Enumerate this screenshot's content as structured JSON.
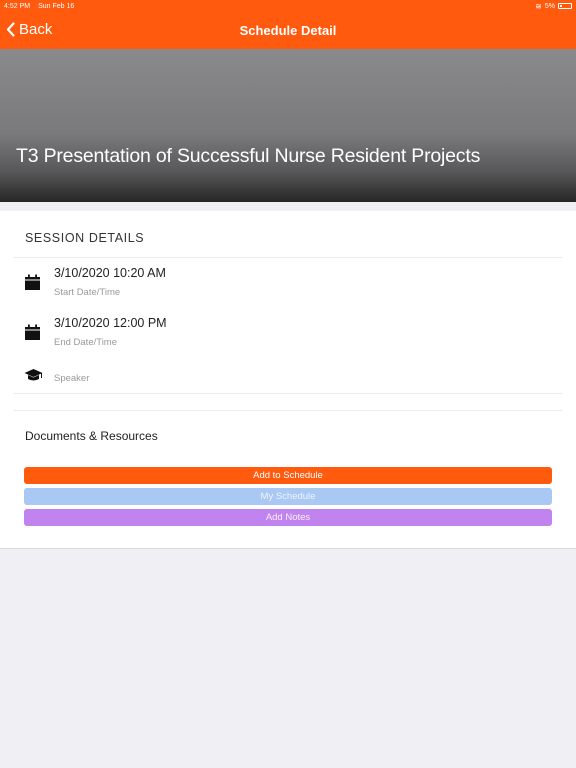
{
  "status_bar": {
    "time": "4:52 PM",
    "date": "Sun Feb 16",
    "battery": "5%"
  },
  "nav": {
    "back_label": "Back",
    "title": "Schedule Detail"
  },
  "hero": {
    "title": "T3 Presentation of Successful Nurse Resident Projects"
  },
  "session": {
    "header": "SESSION DETAILS",
    "start": {
      "value": "3/10/2020 10:20 AM",
      "label": "Start Date/Time",
      "icon": "calendar-icon"
    },
    "end": {
      "value": "3/10/2020 12:00 PM",
      "label": "End Date/Time",
      "icon": "calendar-icon"
    },
    "speaker": {
      "value": "",
      "label": "Speaker",
      "icon": "graduation-cap-icon"
    }
  },
  "documents": {
    "label": "Documents & Resources"
  },
  "buttons": {
    "add": "Add to Schedule",
    "my": "My Schedule",
    "notes": "Add Notes"
  },
  "colors": {
    "accent": "#ff5a0d",
    "my_schedule": "#a9c8f4",
    "add_notes": "#c184ee"
  }
}
